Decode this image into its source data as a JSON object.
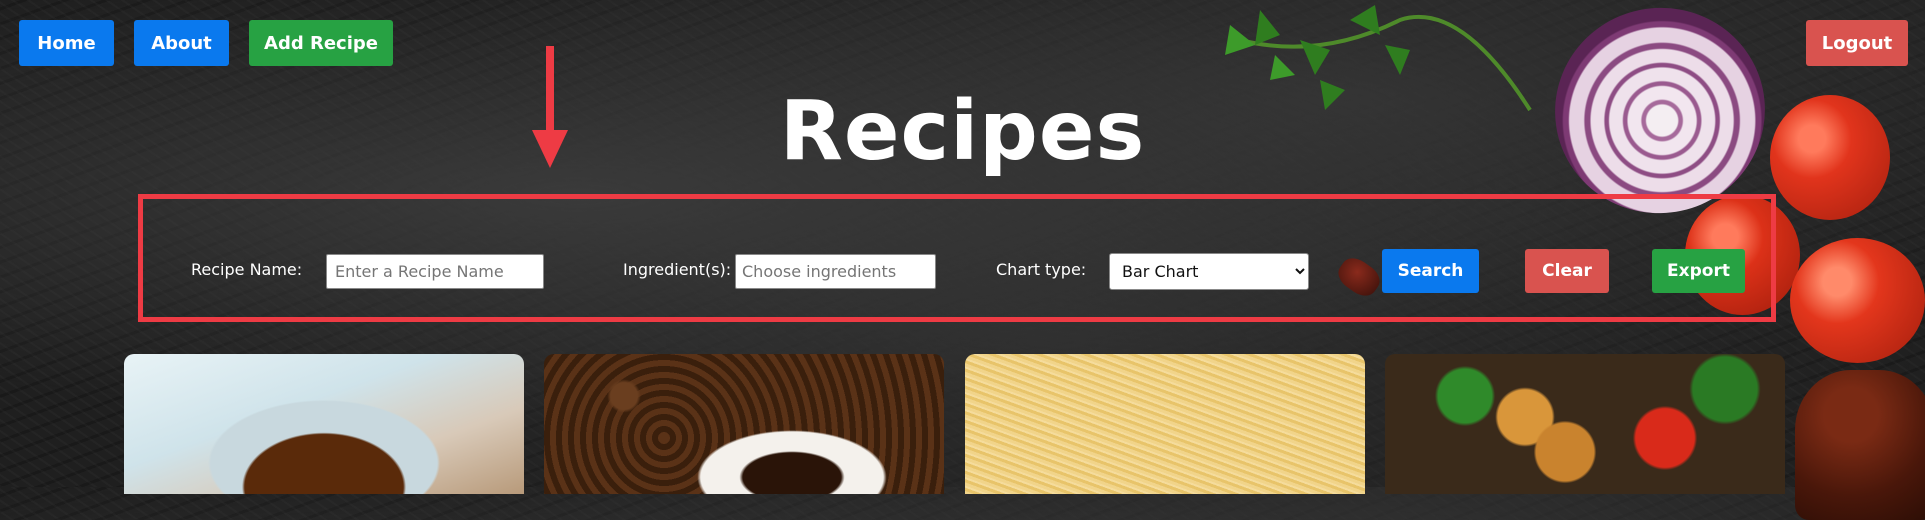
{
  "nav": {
    "home_label": "Home",
    "about_label": "About",
    "add_recipe_label": "Add Recipe",
    "logout_label": "Logout"
  },
  "page": {
    "title": "Recipes"
  },
  "search_bar": {
    "recipe_name_label": "Recipe Name:",
    "recipe_name_placeholder": "Enter a Recipe Name",
    "ingredients_label": "Ingredient(s):",
    "ingredients_placeholder": "Choose ingredients",
    "chart_type_label": "Chart type:",
    "chart_type_selected": "Bar Chart",
    "search_label": "Search",
    "clear_label": "Clear",
    "export_label": "Export"
  },
  "recipe_cards": [
    {
      "image": "tea-image"
    },
    {
      "image": "coffee-image"
    },
    {
      "image": "pasta-image"
    },
    {
      "image": "chicken-stir-fry-image"
    }
  ],
  "colors": {
    "primary_blue": "#0a79ee",
    "success_green": "#27a243",
    "danger_red": "#d9534f",
    "highlight_red": "#ee3b44"
  }
}
